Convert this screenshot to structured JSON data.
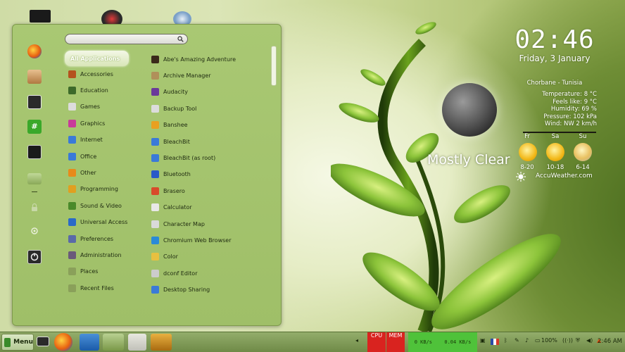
{
  "conky": {
    "time": "02:46",
    "date": "Friday, 3 January",
    "location": "Chorbane - Tunisia",
    "weather_lines": [
      "Temperature: 8 °C",
      "Feels like: 9 °C",
      "Humidity: 69 %",
      "Pressure: 102 kPa",
      "Wind: NW 2 km/h"
    ],
    "condition": "Mostly Clear",
    "forecast": [
      {
        "day": "Fr",
        "temps": "8-20"
      },
      {
        "day": "Sa",
        "temps": "10-18"
      },
      {
        "day": "Su",
        "temps": "6-14"
      }
    ],
    "provider": "AccuWeather.com"
  },
  "menu": {
    "search_placeholder": "",
    "categories": [
      "All Applications",
      "Accessories",
      "Education",
      "Games",
      "Graphics",
      "Internet",
      "Office",
      "Other",
      "Programming",
      "Sound & Video",
      "Universal Access",
      "Preferences",
      "Administration",
      "Places",
      "Recent Files"
    ],
    "category_colors": [
      "#ffffff",
      "#b5521e",
      "#3d6a2a",
      "#dcdcdc",
      "#c83a9a",
      "#3a7ad8",
      "#3a7ad8",
      "#e88a1a",
      "#e0a020",
      "#4a8a2a",
      "#2a6ac8",
      "#5a6aa8",
      "#6a5a7a",
      "#8aa05a",
      "#8aa05a"
    ],
    "apps": [
      "Abe's Amazing Adventure",
      "Archive Manager",
      "Audacity",
      "Backup Tool",
      "Banshee",
      "BleachBit",
      "BleachBit (as root)",
      "Bluetooth",
      "Brasero",
      "Calculator",
      "Character Map",
      "Chromium Web Browser",
      "Color",
      "dconf Editor",
      "Desktop Sharing"
    ],
    "app_colors": [
      "#3a2a1a",
      "#b0905a",
      "#6a3a9a",
      "#dcdcdc",
      "#e8a020",
      "#3a7ad8",
      "#3a7ad8",
      "#2a5ac8",
      "#d84a2a",
      "#e8e8e8",
      "#dadada",
      "#2a8ad8",
      "#e8c040",
      "#cccccc",
      "#3a7ad8"
    ],
    "favorites": [
      "firefox-icon",
      "package-manager-icon",
      "system-settings-icon",
      "terminal-hash-icon",
      "terminal-icon",
      "folder-icon"
    ],
    "session": [
      "lock-icon",
      "logout-icon",
      "power-icon"
    ]
  },
  "panel": {
    "menu_label": "Menu",
    "cpu_label": "CPU",
    "mem_label": "MEM",
    "net_down": "0 KB/s",
    "net_up": "0.04 KB/s",
    "battery": "100%",
    "clock": "2:46 AM",
    "colors": {
      "cpu": "#d9231f",
      "net": "#4fc23a"
    }
  }
}
